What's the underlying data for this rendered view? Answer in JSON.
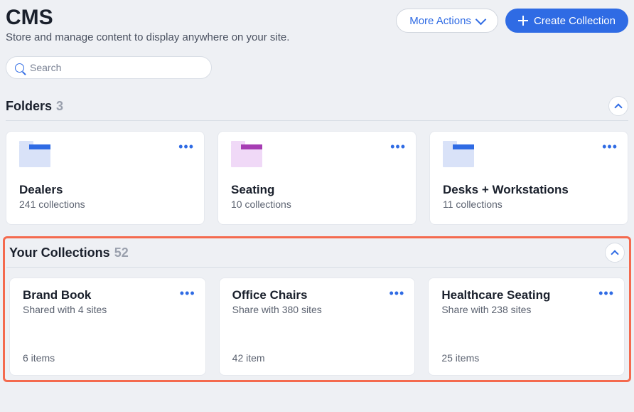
{
  "header": {
    "title": "CMS",
    "subtitle": "Store and manage content to display anywhere on your site.",
    "more_actions": "More Actions",
    "create_collection": "Create Collection"
  },
  "search": {
    "placeholder": "Search"
  },
  "folders": {
    "heading": "Folders",
    "count": "3",
    "items": [
      {
        "name": "Dealers",
        "meta": "241 collections",
        "color": "blue"
      },
      {
        "name": "Seating",
        "meta": "10 collections",
        "color": "purple"
      },
      {
        "name": "Desks + Workstations",
        "meta": "11 collections",
        "color": "blue"
      }
    ]
  },
  "collections": {
    "heading": "Your Collections",
    "count": "52",
    "items": [
      {
        "name": "Brand Book",
        "meta": "Shared with 4 sites",
        "items": "6 items"
      },
      {
        "name": "Office Chairs",
        "meta": "Share with 380 sites",
        "items": "42 item"
      },
      {
        "name": "Healthcare Seating",
        "meta": "Share with 238 sites",
        "items": "25 items"
      }
    ]
  }
}
